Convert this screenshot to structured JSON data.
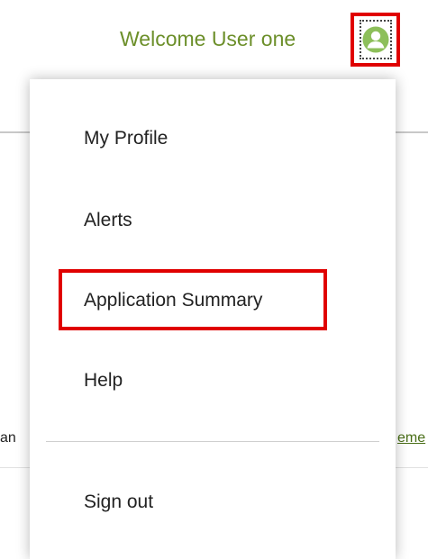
{
  "header": {
    "welcome_text": "Welcome User one",
    "avatar_icon": "user-avatar-icon",
    "avatar_color": "#8dbf5a"
  },
  "menu": {
    "items": [
      {
        "label": "My Profile"
      },
      {
        "label": "Alerts"
      },
      {
        "label": "Application Summary"
      },
      {
        "label": "Help"
      },
      {
        "label": "Sign out"
      }
    ],
    "highlight_color": "#e00000"
  },
  "background": {
    "left_text_fragment": "an",
    "right_link_fragment": "eme"
  }
}
